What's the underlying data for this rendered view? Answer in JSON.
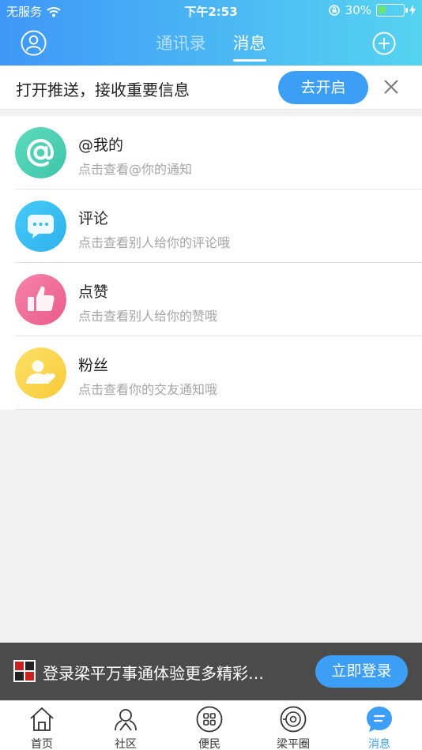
{
  "status_bar": {
    "carrier": "无服务",
    "time": "下午2:53",
    "battery": "30%"
  },
  "nav": {
    "tabs": [
      {
        "label": "通讯录",
        "active": false
      },
      {
        "label": "消息",
        "active": true
      }
    ]
  },
  "push_banner": {
    "text": "打开推送，接收重要信息",
    "button": "去开启"
  },
  "messages": [
    {
      "title": "@我的",
      "subtitle": "点击查看@你的通知",
      "icon": "at-icon",
      "color": "#4ed0b3"
    },
    {
      "title": "评论",
      "subtitle": "点击查看别人给你的评论哦",
      "icon": "comment-icon",
      "color": "#37bdf2"
    },
    {
      "title": "点赞",
      "subtitle": "点击查看别人给你的赞哦",
      "icon": "thumbs-up-icon",
      "color": "#f26e9b"
    },
    {
      "title": "粉丝",
      "subtitle": "点击查看你的交友通知哦",
      "icon": "fans-icon",
      "color": "#fbd54a"
    }
  ],
  "login_bar": {
    "text": "登录梁平万事通体验更多精彩…",
    "button": "立即登录"
  },
  "tabbar": [
    {
      "label": "首页",
      "icon": "home-icon"
    },
    {
      "label": "社区",
      "icon": "community-icon"
    },
    {
      "label": "便民",
      "icon": "services-icon"
    },
    {
      "label": "梁平圈",
      "icon": "circle-icon"
    },
    {
      "label": "消息",
      "icon": "message-icon",
      "active": true
    }
  ],
  "colors": {
    "accent": "#3d9ef5",
    "header_start": "#3f97f7",
    "header_end": "#55d3f0"
  }
}
